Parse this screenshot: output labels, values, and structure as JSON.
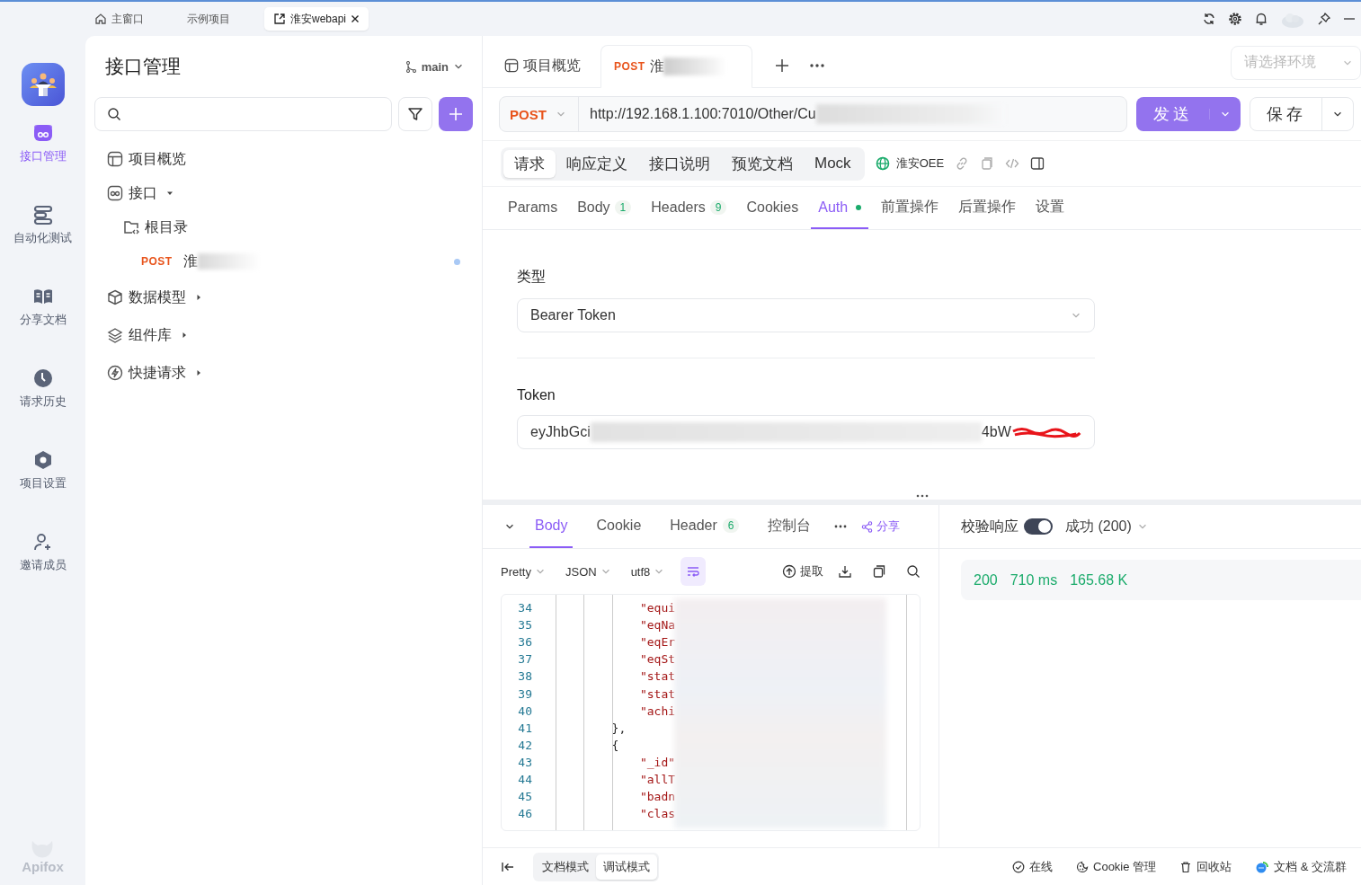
{
  "window_tabs": [
    {
      "kind": "home",
      "label": "主窗口",
      "selected": false,
      "closable": false
    },
    {
      "kind": "plain",
      "label": "示例项目",
      "selected": false,
      "closable": false
    },
    {
      "kind": "project",
      "label": "淮安webapi",
      "selected": true,
      "closable": true
    }
  ],
  "nav": [
    {
      "kind": "api",
      "label": "接口管理",
      "selected": true
    },
    {
      "kind": "auto",
      "label": "自动化测试",
      "selected": false
    },
    {
      "kind": "share",
      "label": "分享文档",
      "selected": false
    },
    {
      "kind": "history",
      "label": "请求历史",
      "selected": false
    },
    {
      "kind": "settings",
      "label": "项目设置",
      "selected": false
    },
    {
      "kind": "invite",
      "label": "邀请成员",
      "selected": false
    }
  ],
  "nav_footer": "Apifox",
  "sidebar": {
    "title": "接口管理",
    "branch": "main",
    "tree": [
      {
        "kind": "overview",
        "label": "项目概览"
      },
      {
        "kind": "api",
        "label": "接口",
        "expanded": true,
        "children": [
          {
            "kind": "folder",
            "label": "根目录",
            "children": [
              {
                "kind": "endpoint",
                "method": "POST",
                "label": "淮",
                "modified": true
              }
            ]
          }
        ]
      },
      {
        "kind": "model",
        "label": "数据模型",
        "expanded": false
      },
      {
        "kind": "components",
        "label": "组件库",
        "expanded": false
      },
      {
        "kind": "quick",
        "label": "快捷请求",
        "expanded": false
      }
    ]
  },
  "main_tabs": [
    {
      "kind": "overview",
      "label": "项目概览",
      "selected": false
    },
    {
      "kind": "request",
      "method": "POST",
      "label": "淮",
      "selected": true
    }
  ],
  "environment": {
    "placeholder": "请选择环境"
  },
  "request": {
    "method": "POST",
    "url": "http://192.168.1.100:7010/Other/Cu",
    "send": "发送",
    "save": "保存"
  },
  "sections": [
    {
      "label": "请求",
      "selected": true
    },
    {
      "label": "响应定义",
      "selected": false
    },
    {
      "label": "接口说明",
      "selected": false
    },
    {
      "label": "预览文档",
      "selected": false
    },
    {
      "label": "Mock",
      "selected": false
    }
  ],
  "service": "淮安OEE",
  "param_tabs": [
    {
      "label": "Params",
      "selected": false,
      "filled": false
    },
    {
      "label": "Body",
      "count": "1",
      "selected": false,
      "filled": false
    },
    {
      "label": "Headers",
      "count": "9",
      "selected": false,
      "filled": false
    },
    {
      "label": "Cookies",
      "selected": false,
      "filled": false
    },
    {
      "label": "Auth",
      "selected": true,
      "filled": true
    },
    {
      "label": "前置操作",
      "selected": false,
      "filled": false
    },
    {
      "label": "后置操作",
      "selected": false,
      "filled": false
    },
    {
      "label": "设置",
      "selected": false,
      "filled": false
    }
  ],
  "auth": {
    "type_label": "类型",
    "type": "Bearer Token",
    "token_label": "Token",
    "token_start": "eyJhbGci",
    "token_end": "4bW"
  },
  "response": {
    "tabs": [
      {
        "label": "Body",
        "selected": true
      },
      {
        "label": "Cookie",
        "selected": false
      },
      {
        "label": "Header",
        "count": "6",
        "selected": false
      },
      {
        "label": "控制台",
        "selected": false
      }
    ],
    "share": "分享",
    "formats": [
      "Pretty",
      "JSON",
      "utf8"
    ],
    "wrap": true,
    "extract": "提取",
    "code_lines": [
      {
        "number": "34",
        "kind": "key",
        "text": "            \"equi"
      },
      {
        "number": "35",
        "kind": "key",
        "text": "            \"eqNa"
      },
      {
        "number": "36",
        "kind": "key",
        "text": "            \"eqEr"
      },
      {
        "number": "37",
        "kind": "key",
        "text": "            \"eqSt"
      },
      {
        "number": "38",
        "kind": "key",
        "text": "            \"stat"
      },
      {
        "number": "39",
        "kind": "key",
        "text": "            \"stat"
      },
      {
        "number": "40",
        "kind": "key",
        "text": "            \"achi"
      },
      {
        "number": "41",
        "kind": "punct",
        "text": "        },"
      },
      {
        "number": "42",
        "kind": "punct",
        "text": "        {"
      },
      {
        "number": "43",
        "kind": "key",
        "text": "            \"_id\""
      },
      {
        "number": "44",
        "kind": "key",
        "text": "            \"allT"
      },
      {
        "number": "45",
        "kind": "key",
        "text": "            \"badn"
      },
      {
        "number": "46",
        "kind": "key",
        "text": "            \"clas"
      }
    ]
  },
  "validation": {
    "label": "校验响应",
    "on": true,
    "result": "成功 (200)"
  },
  "status": {
    "code": "200",
    "time": "710 ms",
    "size": "165.68 K"
  },
  "footer": {
    "modes": [
      {
        "label": "文档模式",
        "selected": false
      },
      {
        "label": "调试模式",
        "selected": true
      }
    ],
    "links": [
      {
        "kind": "online",
        "label": "在线"
      },
      {
        "kind": "cookie",
        "label": "Cookie 管理"
      },
      {
        "kind": "trash",
        "label": "回收站"
      },
      {
        "kind": "chat",
        "label": "文档 & 交流群"
      }
    ]
  }
}
